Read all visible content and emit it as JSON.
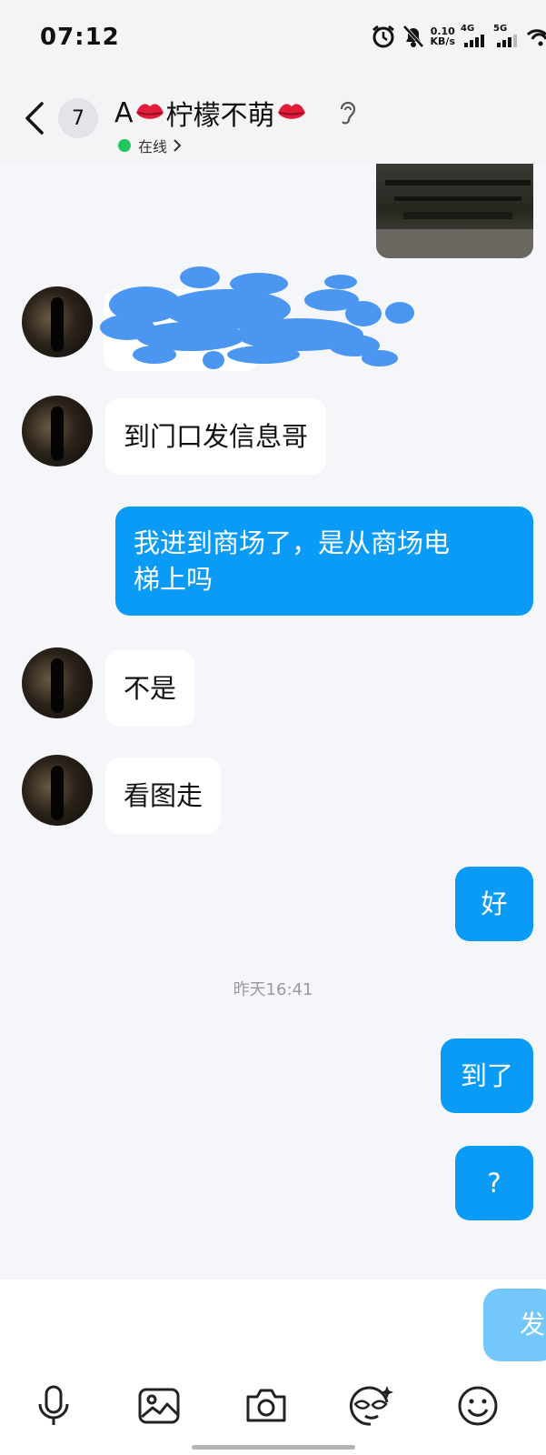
{
  "status_bar": {
    "time": "07:12",
    "net_speed_value": "0.10",
    "net_speed_unit": "KB/s",
    "net1": "4G",
    "net2": "5G",
    "icons": [
      "alarm-icon",
      "mute-bell-icon",
      "signal-icon",
      "signal-icon",
      "wifi-icon"
    ]
  },
  "header": {
    "unread_count": "7",
    "title_prefix": "A",
    "title_main": "柠檬不萌",
    "title_emoji": "💋",
    "status": "在线",
    "icons": [
      "back-arrow-icon",
      "ear-icon",
      "chevron-right-icon"
    ]
  },
  "messages": [
    {
      "side": "left",
      "text": "到门口发信息哥"
    },
    {
      "side": "right",
      "line1": "我进到商场了，是从商场电",
      "line2": "梯上吗"
    },
    {
      "side": "left",
      "text": "不是"
    },
    {
      "side": "left",
      "text": "看图走"
    },
    {
      "side": "right",
      "text": "好"
    },
    {
      "type": "time",
      "text": "昨天16:41"
    },
    {
      "side": "right",
      "text": "到了"
    },
    {
      "side": "right",
      "text": "?"
    }
  ],
  "input": {
    "send_label": "发"
  },
  "toolbar": [
    "microphone-icon",
    "image-icon",
    "camera-icon",
    "sticker-icon",
    "emoji-icon"
  ],
  "colors": {
    "accent": "#0a9bf7",
    "background": "#f5f6fa",
    "online": "#22c55e"
  }
}
